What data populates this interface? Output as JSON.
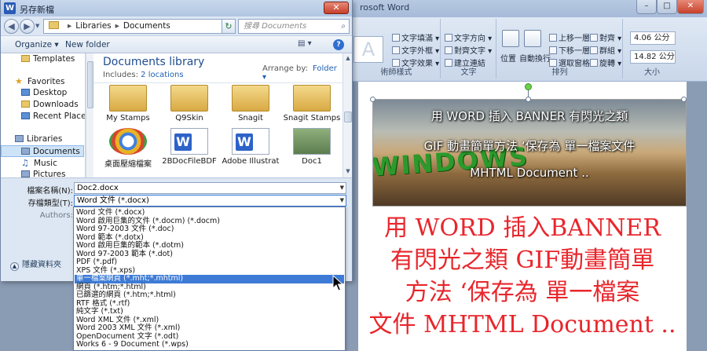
{
  "word": {
    "title": "rosoft Word",
    "ribbon": {
      "text_arrange": [
        "文字填滿",
        "文字外框",
        "文字效果"
      ],
      "text_group": [
        "文字方向",
        "對齊文字",
        "建立連結"
      ],
      "arrange_big": [
        "位置",
        "自動換行"
      ],
      "arrange_small": [
        "上移一層",
        "下移一層",
        "選取窗格",
        "對齊",
        "群組",
        "旋轉"
      ],
      "size_height": "4.06 公分",
      "size_width": "14.82 公分",
      "group_labels": [
        "術師樣式",
        "文字",
        "排列",
        "大小"
      ]
    },
    "banner": {
      "logo": "WINDOWS",
      "lines": [
        "用  WORD  插入 BANNER  有閃光之類",
        "GIF 動畫簡單方法  ‘保存為  單一檔案文件",
        "MHTML Document .."
      ]
    },
    "big_text": [
      "用 WORD 插入BANNER",
      "有閃光之類 GIF動畫簡單",
      "方法 ‘保存為 單一檔案",
      "文件 MHTML Document .."
    ]
  },
  "dialog": {
    "icon_letter": "W",
    "title": "另存新檔",
    "close": "✕",
    "breadcrumb": [
      "Libraries",
      "Documents"
    ],
    "search_placeholder": "搜尋 Documents",
    "toolbar": {
      "organize": "Organize",
      "new_folder": "New folder"
    },
    "nav": [
      {
        "label": "Templates",
        "icon": "folder-icon"
      },
      {
        "label": "Favorites",
        "icon": "star-icon"
      },
      {
        "label": "Desktop",
        "icon": "desktop-icon"
      },
      {
        "label": "Downloads",
        "icon": "downloads-icon"
      },
      {
        "label": "Recent Places",
        "icon": "recent-places-icon"
      },
      {
        "label": "Libraries",
        "icon": "library-icon"
      },
      {
        "label": "Documents",
        "icon": "documents-icon"
      },
      {
        "label": "Music",
        "icon": "music-icon"
      },
      {
        "label": "Pictures",
        "icon": "pictures-icon"
      }
    ],
    "library": {
      "title": "Documents library",
      "includes_label": "Includes:",
      "includes_link": "2 locations",
      "arrange_label": "Arrange by:",
      "arrange_value": "Folder"
    },
    "files": [
      {
        "name": "My Stamps",
        "kind": "folder"
      },
      {
        "name": "Q9Skin",
        "kind": "folder"
      },
      {
        "name": "Snagit",
        "kind": "folder"
      },
      {
        "name": "Snagit Stamps",
        "kind": "folder"
      },
      {
        "name": "桌面壓縮檔案",
        "kind": "chrome"
      },
      {
        "name": "2BDocFileBDF",
        "kind": "word"
      },
      {
        "name": "Adobe Illustrat",
        "kind": "word"
      },
      {
        "name": "Doc1",
        "kind": "image"
      }
    ],
    "form": {
      "filename_label": "檔案名稱(N):",
      "filename_value": "Doc2.docx",
      "filetype_label": "存檔類型(T):",
      "filetype_value": "Word 文件 (*.docx)",
      "authors_label": "Authors:",
      "hide_folders": "隱藏資料夾"
    },
    "filetypes": [
      "Word 文件 (*.docx)",
      "Word 啟用巨集的文件 (*.docm) (*.docm)",
      "Word 97-2003 文件 (*.doc)",
      "Word 範本 (*.dotx)",
      "Word 啟用巨集的範本 (*.dotm)",
      "Word 97-2003 範本 (*.dot)",
      "PDF (*.pdf)",
      "XPS 文件 (*.xps)",
      "單一檔案網頁 (*.mht;*.mhtml)",
      "網頁 (*.htm;*.html)",
      "已篩選的網頁 (*.htm;*.html)",
      "RTF 格式 (*.rtf)",
      "純文字 (*.txt)",
      "Word XML 文件 (*.xml)",
      "Word 2003 XML 文件 (*.xml)",
      "OpenDocument 文字 (*.odt)",
      "Works 6 - 9 Document (*.wps)"
    ],
    "selected_filetype_index": 8
  },
  "colors": {
    "accent": "#3d7bd6",
    "red_text": "#e8262c",
    "lib_title": "#1f4e8f"
  }
}
